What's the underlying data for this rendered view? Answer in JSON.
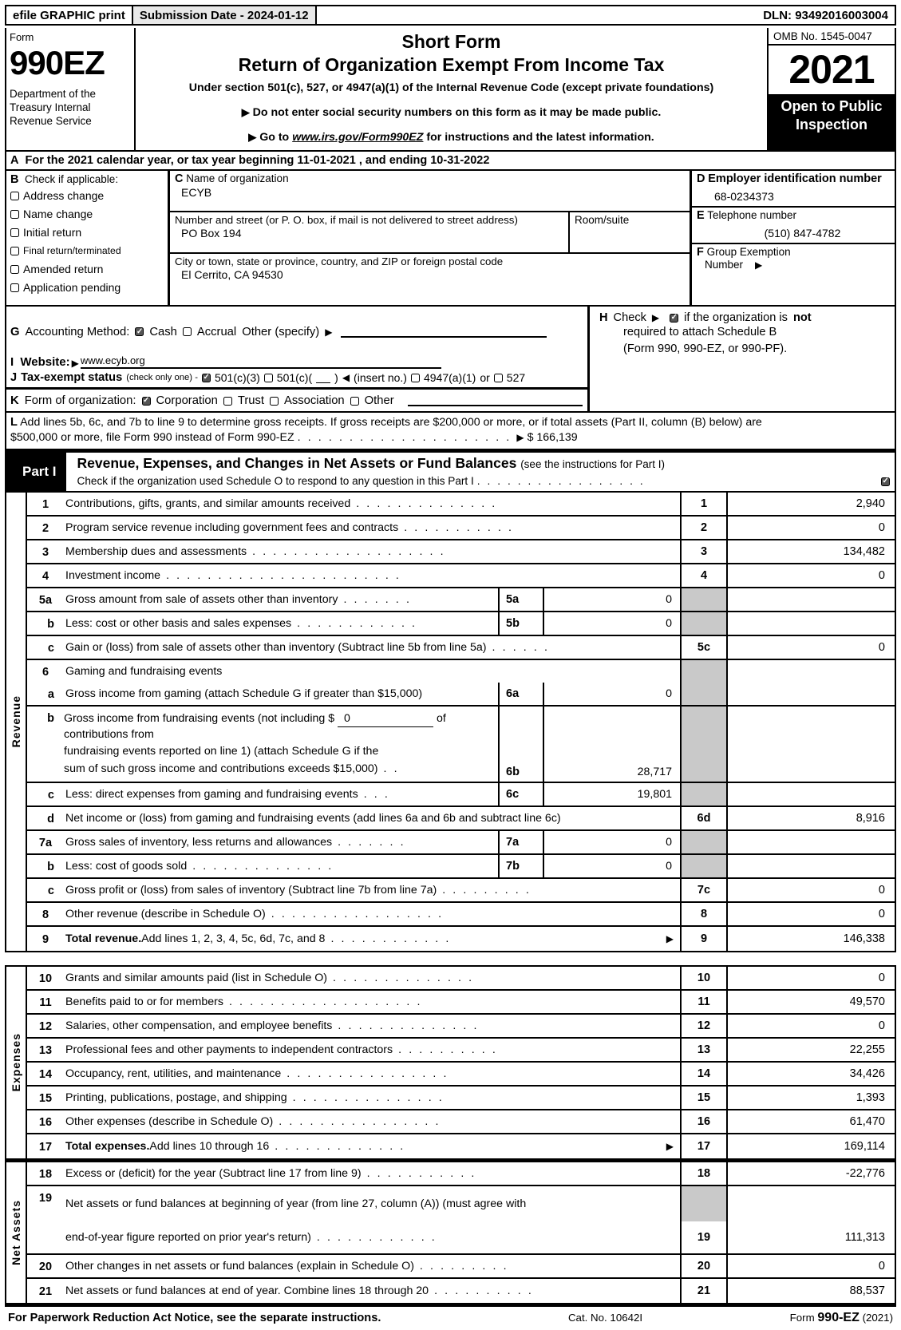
{
  "efile": {
    "graphic_print": "efile GRAPHIC print",
    "submission_date": "Submission Date - 2024-01-12",
    "dln": "DLN: 93492016003004"
  },
  "masthead": {
    "form_label": "Form",
    "form_number": "990EZ",
    "department": "Department of the Treasury Internal Revenue Service",
    "short_form": "Short Form",
    "title": "Return of Organization Exempt From Income Tax",
    "under_section": "Under section 501(c), 527, or 4947(a)(1) of the Internal Revenue Code (except private foundations)",
    "bullet_ssn": "Do not enter social security numbers on this form as it may be made public.",
    "bullet_goto_prefix": "Go to",
    "bullet_goto_url": "www.irs.gov/Form990EZ",
    "bullet_goto_suffix": "for instructions and the latest information.",
    "omb": "OMB No. 1545-0047",
    "year": "2021",
    "open_to_public": "Open to Public Inspection"
  },
  "line_a": {
    "letter": "A",
    "text": "For the 2021 calendar year, or tax year beginning 11-01-2021 , and ending 10-31-2022"
  },
  "section_b": {
    "letter": "B",
    "heading": "Check if applicable:",
    "items": [
      {
        "label": "Address change",
        "checked": false
      },
      {
        "label": "Name change",
        "checked": false
      },
      {
        "label": "Initial return",
        "checked": false
      },
      {
        "label": "Final return/terminated",
        "checked": false
      },
      {
        "label": "Amended return",
        "checked": false
      },
      {
        "label": "Application pending",
        "checked": false
      }
    ]
  },
  "section_c": {
    "letter": "C",
    "name_caption": "Name of organization",
    "name_value": "ECYB",
    "street_caption": "Number and street (or P. O. box, if mail is not delivered to street address)",
    "street_value": "PO Box 194",
    "room_caption": "Room/suite",
    "room_value": "",
    "city_caption": "City or town, state or province, country, and ZIP or foreign postal code",
    "city_value": "El Cerrito, CA  94530"
  },
  "section_d": {
    "letter": "D",
    "ein_caption": "Employer identification number",
    "ein_value": "68-0234373",
    "tel_letter": "E",
    "tel_caption": "Telephone number",
    "tel_value": "(510) 847-4782",
    "group_letter": "F",
    "group_caption_1": "Group Exemption",
    "group_caption_2": "Number",
    "group_value": ""
  },
  "section_g": {
    "letter": "G",
    "label": "Accounting Method:",
    "cash": "Cash",
    "cash_checked": true,
    "accrual": "Accrual",
    "accrual_checked": false,
    "other": "Other (specify)"
  },
  "section_h": {
    "letter": "H",
    "check_label": "Check",
    "checked": true,
    "text_1": "if the organization is",
    "text_not": "not",
    "text_2": "required to attach Schedule B",
    "text_3": "(Form 990, 990-EZ, or 990-PF)."
  },
  "section_i": {
    "letter": "I",
    "label": "Website:",
    "value": "www.ecyb.org"
  },
  "section_j": {
    "letter": "J",
    "label": "Tax-exempt status",
    "note": "(check only one) -",
    "opt1": "501(c)(3)",
    "opt1_checked": true,
    "opt2": "501(c)(",
    "opt2_checked": false,
    "opt2_suffix": ")",
    "insert_no": "(insert no.)",
    "opt3": "4947(a)(1)",
    "opt3_checked": false,
    "or_text": "or",
    "opt4": "527",
    "opt4_checked": false
  },
  "section_k": {
    "letter": "K",
    "label": "Form of organization:",
    "options": [
      {
        "label": "Corporation",
        "checked": true
      },
      {
        "label": "Trust",
        "checked": false
      },
      {
        "label": "Association",
        "checked": false
      },
      {
        "label": "Other",
        "checked": false
      }
    ]
  },
  "section_l": {
    "letter": "L",
    "text_1": "Add lines 5b, 6c, and 7b to line 9 to determine gross receipts. If gross receipts are $200,000 or more, or if total assets (Part II, column (B) below) are",
    "text_2": "$500,000 or more, file Form 990 instead of Form 990-EZ",
    "amount": "$ 166,139"
  },
  "part1": {
    "tab": "Part I",
    "title": "Revenue, Expenses, and Changes in Net Assets or Fund Balances",
    "title_thin": "(see the instructions for Part I)",
    "subtitle": "Check if the organization used Schedule O to respond to any question in this Part I",
    "sched_o_checked": true
  },
  "revenue": {
    "vertical_label": "Revenue",
    "lines": [
      {
        "num": "1",
        "text": "Contributions, gifts, grants, and similar amounts received",
        "dots": ". . . . . . . . . . . . . .",
        "main_num": "1",
        "value": "2,940"
      },
      {
        "num": "2",
        "text": "Program service revenue including government fees and contracts",
        "dots": ". . . . . . . . . . .",
        "main_num": "2",
        "value": "0"
      },
      {
        "num": "3",
        "text": "Membership dues and assessments",
        "dots": ". . . . . . . . . . . . . . . . . . .",
        "main_num": "3",
        "value": "134,482"
      },
      {
        "num": "4",
        "text": "Investment income",
        "dots": ". . . . . . . . . . . . . . . . . . . . . . .",
        "main_num": "4",
        "value": "0"
      },
      {
        "num": "5a",
        "text": "Gross amount from sale of assets other than inventory",
        "dots": ". . . . . . .",
        "sub_num": "5a",
        "sub_value": "0",
        "main_num": "",
        "value": ""
      },
      {
        "num": "b",
        "indent": true,
        "text": "Less: cost or other basis and sales expenses",
        "dots": ". . . . . . . . . . . .",
        "sub_num": "5b",
        "sub_value": "0",
        "main_num": "",
        "value": ""
      },
      {
        "num": "c",
        "indent": true,
        "text": "Gain or (loss) from sale of assets other than inventory (Subtract line 5b from line 5a)",
        "dots": ". . . . . .",
        "main_num": "5c",
        "value": "0"
      },
      {
        "num": "6",
        "text": "Gaming and fundraising events",
        "dots": "",
        "main_num": "",
        "value": ""
      },
      {
        "num": "a",
        "indent": true,
        "text": "Gross income from gaming (attach Schedule G if greater than $15,000)",
        "dots": "",
        "sub_num": "6a",
        "sub_value": "0",
        "main_num": "",
        "value": ""
      },
      {
        "num": "b",
        "indent": true,
        "text_multiline": [
          "Gross income from fundraising events (not including $ __0__ of contributions from",
          "fundraising events reported on line 1) (attach Schedule G if the",
          "sum of such gross income and contributions exceeds $15,000)"
        ],
        "inline_amount": "0",
        "dots": ". .",
        "sub_num": "6b",
        "sub_value": "28,717",
        "main_num": "",
        "value": ""
      },
      {
        "num": "c",
        "indent": true,
        "text": "Less: direct expenses from gaming and fundraising events",
        "dots": ". . .",
        "sub_num": "6c",
        "sub_value": "19,801",
        "main_num": "",
        "value": ""
      },
      {
        "num": "d",
        "indent": true,
        "text": "Net income or (loss) from gaming and fundraising events (add lines 6a and 6b and subtract line 6c)",
        "dots": "",
        "main_num": "6d",
        "value": "8,916"
      },
      {
        "num": "7a",
        "text": "Gross sales of inventory, less returns and allowances",
        "dots": ". . . . . . .",
        "sub_num": "7a",
        "sub_value": "0",
        "main_num": "",
        "value": ""
      },
      {
        "num": "b",
        "indent": true,
        "text": "Less: cost of goods sold",
        "dots": ". . . . . . . . . . . . . .",
        "sub_num": "7b",
        "sub_value": "0",
        "main_num": "",
        "value": ""
      },
      {
        "num": "c",
        "indent": true,
        "text": "Gross profit or (loss) from sales of inventory (Subtract line 7b from line 7a)",
        "dots": ". . . . . . . . .",
        "main_num": "7c",
        "value": "0"
      },
      {
        "num": "8",
        "text": "Other revenue (describe in Schedule O)",
        "dots": ". . . . . . . . . . . . . . . . .",
        "main_num": "8",
        "value": "0"
      },
      {
        "num": "9",
        "text_bold": "Total revenue.",
        "text": " Add lines 1, 2, 3, 4, 5c, 6d, 7c, and 8",
        "dots": ". . . . . . . . . . . .",
        "arrow": true,
        "main_num": "9",
        "value": "146,338"
      }
    ]
  },
  "expenses": {
    "vertical_label": "Expenses",
    "lines": [
      {
        "num": "10",
        "text": "Grants and similar amounts paid (list in Schedule O)",
        "dots": ". . . . . . . . . . . . . .",
        "main_num": "10",
        "value": "0"
      },
      {
        "num": "11",
        "text": "Benefits paid to or for members",
        "dots": ". . . . . . . . . . . . . . . . . . .",
        "main_num": "11",
        "value": "49,570"
      },
      {
        "num": "12",
        "text": "Salaries, other compensation, and employee benefits",
        "dots": ". . . . . . . . . . . . . .",
        "main_num": "12",
        "value": "0"
      },
      {
        "num": "13",
        "text": "Professional fees and other payments to independent contractors",
        "dots": ". . . . . . . . . .",
        "main_num": "13",
        "value": "22,255"
      },
      {
        "num": "14",
        "text": "Occupancy, rent, utilities, and maintenance",
        "dots": ". . . . . . . . . . . . . . . .",
        "main_num": "14",
        "value": "34,426"
      },
      {
        "num": "15",
        "text": "Printing, publications, postage, and shipping",
        "dots": ". . . . . . . . . . . . . . .",
        "main_num": "15",
        "value": "1,393"
      },
      {
        "num": "16",
        "text": "Other expenses (describe in Schedule O)",
        "dots": ". . . . . . . . . . . . . . . .",
        "main_num": "16",
        "value": "61,470"
      },
      {
        "num": "17",
        "text_bold": "Total expenses.",
        "text": " Add lines 10 through 16",
        "dots": ". . . . . . . . . . . . .",
        "arrow": true,
        "main_num": "17",
        "value": "169,114"
      }
    ]
  },
  "net_assets": {
    "vertical_label": "Net Assets",
    "lines": [
      {
        "num": "18",
        "text": "Excess or (deficit) for the year (Subtract line 17 from line 9)",
        "dots": ". . . . . . . . . . .",
        "main_num": "18",
        "value": "-22,776"
      },
      {
        "num": "19",
        "text_multiline": [
          "Net assets or fund balances at beginning of year (from line 27, column (A)) (must agree with",
          "end-of-year figure reported on prior year's return)"
        ],
        "dots": ". . . . . . . . . . . .",
        "main_num": "19",
        "value": "111,313"
      },
      {
        "num": "20",
        "text": "Other changes in net assets or fund balances (explain in Schedule O)",
        "dots": ". . . . . . . . .",
        "main_num": "20",
        "value": "0"
      },
      {
        "num": "21",
        "text": "Net assets or fund balances at end of year. Combine lines 18 through 20",
        "dots": ". . . . . . . . . .",
        "main_num": "21",
        "value": "88,537"
      }
    ]
  },
  "footer": {
    "left": "For Paperwork Reduction Act Notice, see the separate instructions.",
    "center": "Cat. No. 10642I",
    "right_prefix": "Form",
    "right_bold": "990-EZ",
    "right_suffix": "(2021)"
  }
}
